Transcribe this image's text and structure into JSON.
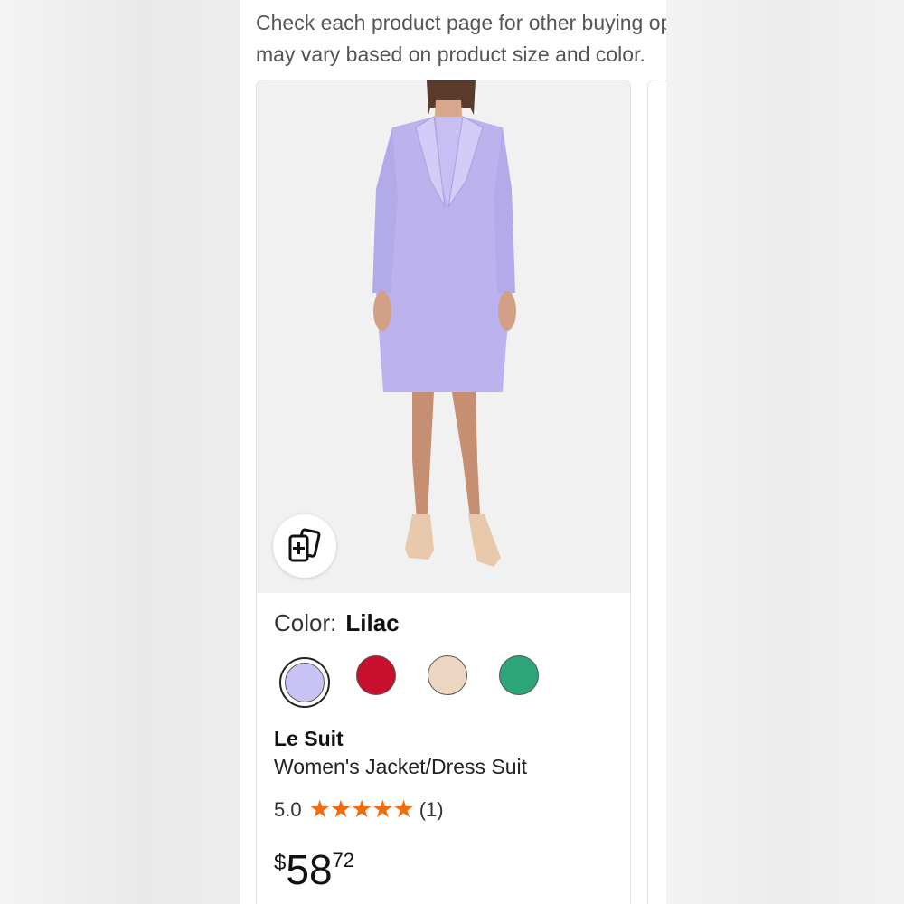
{
  "intro": {
    "line1": "Check each product page for other buying options. Price and other details",
    "line2": "may vary based on product size and color."
  },
  "product": {
    "color_label": "Color:",
    "color_value": "Lilac",
    "swatches": [
      {
        "name": "Lilac",
        "color": "#c9c2f5",
        "selected": true
      },
      {
        "name": "Red",
        "color": "#c8102e",
        "selected": false
      },
      {
        "name": "Beige",
        "color": "#ecd6c2",
        "selected": false
      },
      {
        "name": "Green",
        "color": "#2ea578",
        "selected": false
      }
    ],
    "brand": "Le Suit",
    "title": "Women's Jacket/Dress Suit",
    "rating": "5.0",
    "stars": 5,
    "review_count": "(1)",
    "price": {
      "currency": "$",
      "whole": "58",
      "fraction": "72"
    },
    "compare_icon": "add-to-compare-icon"
  },
  "colors": {
    "star": "#f36d10",
    "garment": "#bcb3ee"
  }
}
